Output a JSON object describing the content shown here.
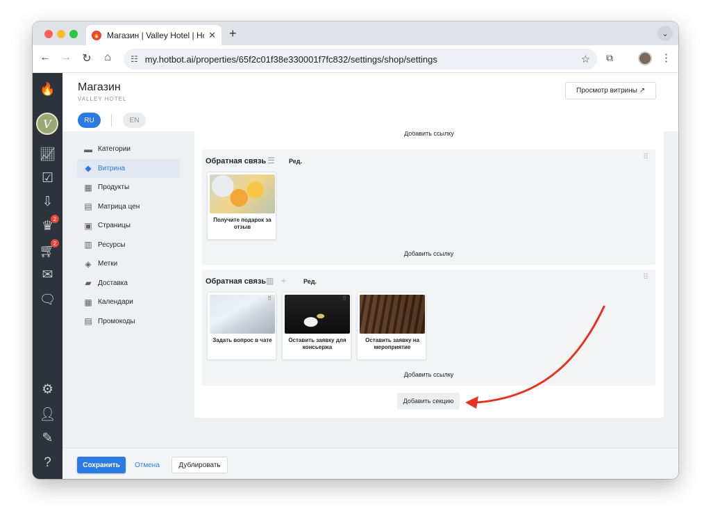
{
  "browser": {
    "tab_title": "Магазин | Valley Hotel | Hotbot",
    "url": "my.hotbot.ai/properties/65f2c01f38e330001f7fc832/settings/shop/settings"
  },
  "rail": {
    "avatar_letter": "V",
    "badges": {
      "orders": "2",
      "cart": "2"
    }
  },
  "header": {
    "title": "Магазин",
    "subtitle": "VALLEY HOTEL",
    "storefront_label": "Просмотр витрины ↗",
    "languages": [
      "RU",
      "EN"
    ]
  },
  "submenu": [
    {
      "label": "Категории",
      "icon": "store-icon",
      "active": false
    },
    {
      "label": "Витрина",
      "icon": "showcase-icon",
      "active": true
    },
    {
      "label": "Продукты",
      "icon": "grid-icon",
      "active": false
    },
    {
      "label": "Матрица цен",
      "icon": "calculator-icon",
      "active": false
    },
    {
      "label": "Страницы",
      "icon": "page-icon",
      "active": false
    },
    {
      "label": "Ресурсы",
      "icon": "resources-icon",
      "active": false
    },
    {
      "label": "Метки",
      "icon": "tag-icon",
      "active": false
    },
    {
      "label": "Доставка",
      "icon": "truck-icon",
      "active": false
    },
    {
      "label": "Календари",
      "icon": "calendar-icon",
      "active": false
    },
    {
      "label": "Промокоды",
      "icon": "promo-icon",
      "active": false
    }
  ],
  "showcase": {
    "top_add_link": "Добавить ссылку",
    "sections": [
      {
        "title": "Обратная связь",
        "edit_label": "Ред.",
        "add_link_label": "Добавить ссылку",
        "cards": [
          {
            "label": "Получите подарок за отзыв"
          }
        ]
      },
      {
        "title": "Обратная связь",
        "edit_label": "Ред.",
        "add_link_label": "Добавить ссылку",
        "cards": [
          {
            "label": "Задать вопрос в чате"
          },
          {
            "label": "Оставить заявку для консьержа"
          },
          {
            "label": "Оставить заявку на мероприятие"
          }
        ]
      }
    ],
    "add_section_label": "Добавить секцию"
  },
  "footer": {
    "save_label": "Сохранить",
    "cancel_label": "Отмена",
    "duplicate_label": "Дублировать"
  },
  "colors": {
    "accent": "#2c7be5",
    "rail": "#2d333b",
    "annotation_arrow": "#e8321f",
    "badge": "#e8463d"
  }
}
